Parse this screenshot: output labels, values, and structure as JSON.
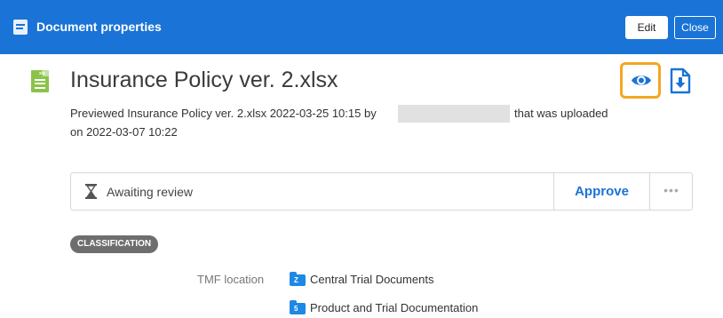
{
  "window": {
    "title": "Document properties",
    "edit_label": "Edit",
    "close_label": "Close"
  },
  "document": {
    "file_type_icon": "xlsx-file-icon",
    "file_ext": "xls",
    "title": "Insurance Policy ver. 2.xlsx",
    "preview_line_part1": "Previewed Insurance Policy ver. 2.xlsx 2022-03-25 10:15 by",
    "preview_line_part2": "that was uploaded",
    "preview_line_2": "on 2022-03-07 10:22"
  },
  "actions": {
    "view_icon": "eye-icon",
    "download_icon": "download-file-icon",
    "highlight_color": "#f5a623"
  },
  "review": {
    "status_icon": "hourglass-icon",
    "status": "Awaiting review",
    "approve_label": "Approve",
    "more_label": "•••"
  },
  "classification": {
    "badge": "CLASSIFICATION",
    "tmf_label": "TMF location",
    "locations": [
      {
        "folder_code": "Z",
        "label": "Central Trial Documents"
      },
      {
        "folder_code": "5",
        "label": "Product and Trial Documentation"
      }
    ]
  },
  "colors": {
    "accent": "#1a73d6",
    "file_green": "#8bc34a",
    "badge_gray": "#6e6e6e"
  }
}
